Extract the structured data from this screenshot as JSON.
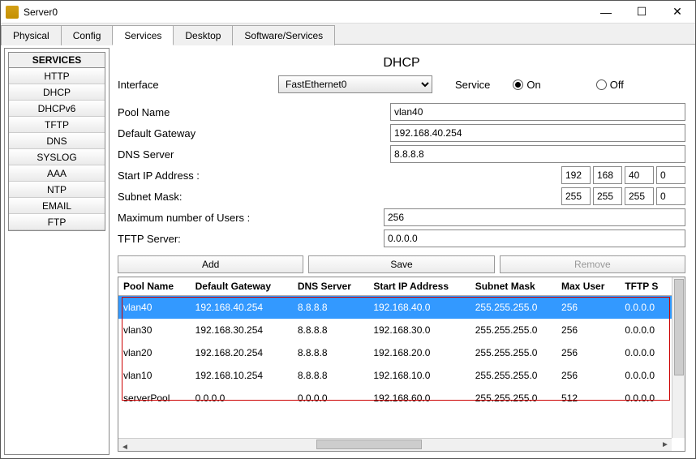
{
  "window": {
    "title": "Server0"
  },
  "tabs": {
    "items": [
      "Physical",
      "Config",
      "Services",
      "Desktop",
      "Software/Services"
    ],
    "active": 2
  },
  "sidebar": {
    "header": "SERVICES",
    "items": [
      "HTTP",
      "DHCP",
      "DHCPv6",
      "TFTP",
      "DNS",
      "SYSLOG",
      "AAA",
      "NTP",
      "EMAIL",
      "FTP"
    ]
  },
  "page": {
    "title": "DHCP",
    "interface_label": "Interface",
    "interface_value": "FastEthernet0",
    "service_label": "Service",
    "on_label": "On",
    "off_label": "Off",
    "service_on": true,
    "pool_name_label": "Pool Name",
    "pool_name": "vlan40",
    "gateway_label": "Default Gateway",
    "gateway": "192.168.40.254",
    "dns_label": "DNS Server",
    "dns": "8.8.8.8",
    "start_ip_label": "Start IP Address :",
    "start_ip": [
      "192",
      "168",
      "40",
      "0"
    ],
    "mask_label": "Subnet Mask:",
    "mask": [
      "255",
      "255",
      "255",
      "0"
    ],
    "max_users_label": "Maximum number of Users :",
    "max_users": "256",
    "tftp_label": "TFTP Server:",
    "tftp": "0.0.0.0",
    "btn_add": "Add",
    "btn_save": "Save",
    "btn_remove": "Remove"
  },
  "table": {
    "headers": [
      "Pool Name",
      "Default Gateway",
      "DNS Server",
      "Start IP Address",
      "Subnet Mask",
      "Max User",
      "TFTP S"
    ],
    "rows": [
      {
        "pool": "vlan40",
        "gw": "192.168.40.254",
        "dns": "8.8.8.8",
        "start": "192.168.40.0",
        "mask": "255.255.255.0",
        "max": "256",
        "tftp": "0.0.0.0",
        "selected": true
      },
      {
        "pool": "vlan30",
        "gw": "192.168.30.254",
        "dns": "8.8.8.8",
        "start": "192.168.30.0",
        "mask": "255.255.255.0",
        "max": "256",
        "tftp": "0.0.0.0"
      },
      {
        "pool": "vlan20",
        "gw": "192.168.20.254",
        "dns": "8.8.8.8",
        "start": "192.168.20.0",
        "mask": "255.255.255.0",
        "max": "256",
        "tftp": "0.0.0.0"
      },
      {
        "pool": "vlan10",
        "gw": "192.168.10.254",
        "dns": "8.8.8.8",
        "start": "192.168.10.0",
        "mask": "255.255.255.0",
        "max": "256",
        "tftp": "0.0.0.0"
      },
      {
        "pool": "serverPool",
        "gw": "0.0.0.0",
        "dns": "0.0.0.0",
        "start": "192.168.60.0",
        "mask": "255.255.255.0",
        "max": "512",
        "tftp": "0.0.0.0"
      }
    ]
  }
}
